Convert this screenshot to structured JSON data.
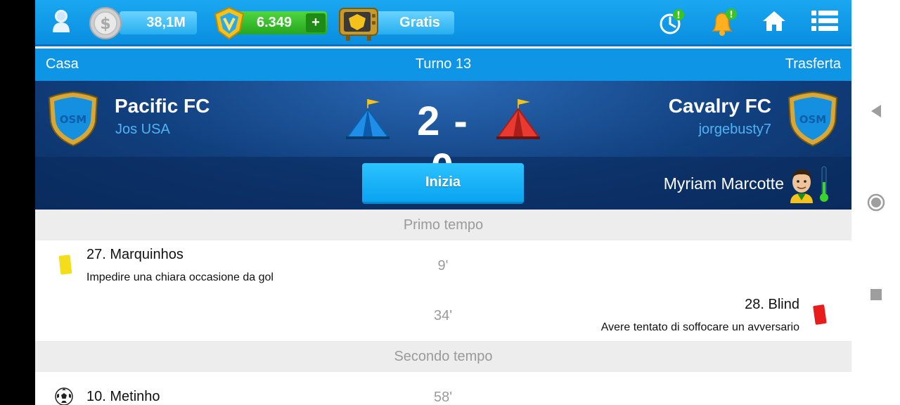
{
  "topbar": {
    "coins": "38,1M",
    "boss_coins": "6.349",
    "boss_coins_add": "+",
    "tv_label": "Gratis",
    "colors": {
      "bar": "#0a8ee0",
      "pill_blue": "#27aef0",
      "pill_green": "#27a61e"
    }
  },
  "match_header": {
    "home_label": "Casa",
    "round": "Turno 13",
    "away_label": "Trasferta"
  },
  "match": {
    "home_team": "Pacific FC",
    "home_manager": "Jos USA",
    "away_team": "Cavalry FC",
    "away_manager": "jorgebusty7",
    "score": "2 - 0",
    "start_button": "Inizia",
    "referee": "Myriam Marcotte",
    "badge_text": "OSM"
  },
  "sections": [
    {
      "title": "Primo tempo",
      "events": [
        {
          "side": "home",
          "player": "27. Marquinhos",
          "description": "Impedire una chiara occasione da gol",
          "minute": "9'",
          "icon": "yellow-card-icon"
        },
        {
          "side": "away",
          "player": "28. Blind",
          "description": "Avere tentato di soffocare un avversario",
          "minute": "34'",
          "icon": "red-card-icon"
        }
      ]
    },
    {
      "title": "Secondo tempo",
      "events": [
        {
          "side": "home",
          "player": "10. Metinho",
          "description": "",
          "minute": "58'",
          "icon": "goal-ball-icon"
        }
      ]
    }
  ]
}
